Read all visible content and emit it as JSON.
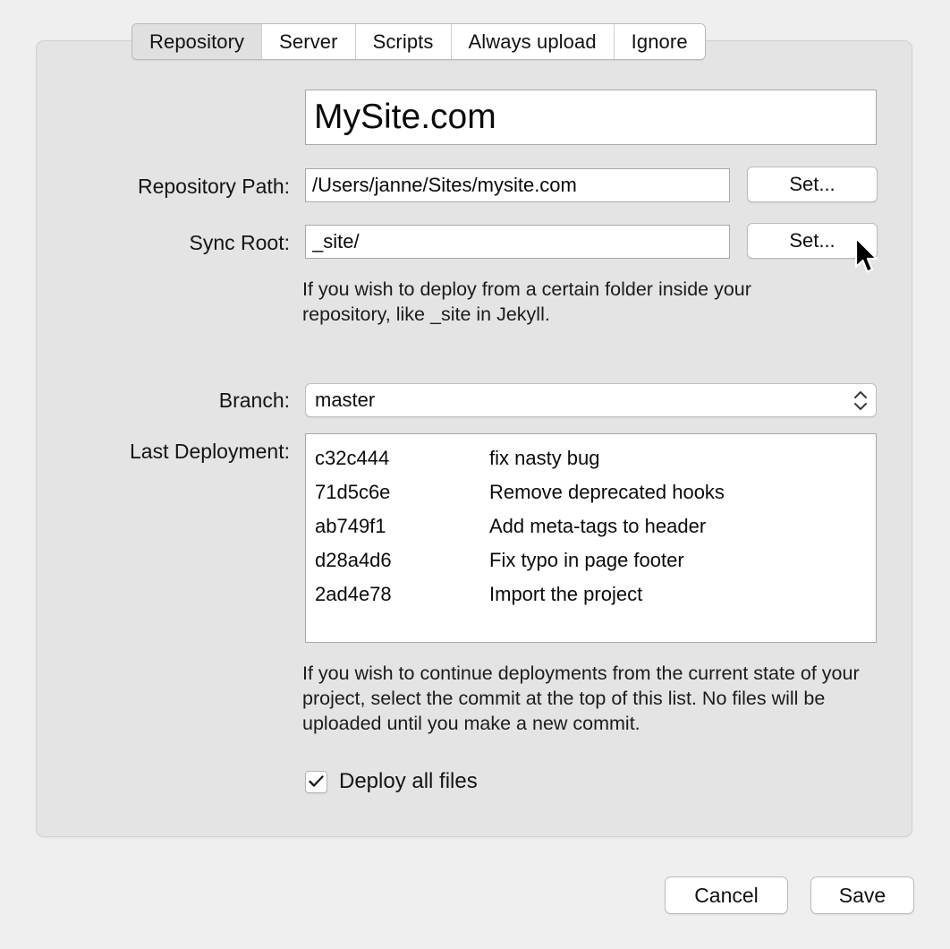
{
  "tabs": [
    {
      "label": "Repository",
      "active": true
    },
    {
      "label": "Server",
      "active": false
    },
    {
      "label": "Scripts",
      "active": false
    },
    {
      "label": "Always upload",
      "active": false
    },
    {
      "label": "Ignore",
      "active": false
    }
  ],
  "site": {
    "name_value": "MySite.com",
    "name_placeholder": "Site name"
  },
  "repository_path": {
    "label": "Repository Path:",
    "value": "/Users/janne/Sites/mysite.com",
    "placeholder": "Path to repository",
    "button_label": "Set..."
  },
  "sync_root": {
    "label": "Sync Root:",
    "value": "_site/",
    "placeholder": "Sync root folder",
    "button_label": "Set...",
    "help": "If you wish to deploy from a certain folder inside your repository, like _site in Jekyll."
  },
  "branch": {
    "label": "Branch:",
    "selected": "master",
    "stepper_icon": "chevron-up-down-icon"
  },
  "last_deployment": {
    "label": "Last Deployment:",
    "commits": [
      {
        "hash": "c32c444",
        "message": "fix nasty bug"
      },
      {
        "hash": "71d5c6e",
        "message": "Remove deprecated hooks"
      },
      {
        "hash": "ab749f1",
        "message": "Add meta-tags to header"
      },
      {
        "hash": "d28a4d6",
        "message": "Fix typo in page footer"
      },
      {
        "hash": "2ad4e78",
        "message": "Import the project"
      }
    ],
    "help": "If you wish to continue deployments from the current state of your project, select the commit at the top of this list. No files will be uploaded until you make a new commit."
  },
  "deploy_all": {
    "label": "Deploy all files",
    "checked": true,
    "check_icon": "checkmark-icon"
  },
  "footer": {
    "cancel_label": "Cancel",
    "save_label": "Save"
  },
  "cursor": {
    "icon": "arrow-pointer-icon"
  },
  "colors": {
    "window_background": "#efefef",
    "panel_background": "#e4e4e4",
    "field_background": "#ffffff",
    "active_tab_background": "#e0e0e0",
    "text": "#141414",
    "border": "#a8a8a8"
  }
}
